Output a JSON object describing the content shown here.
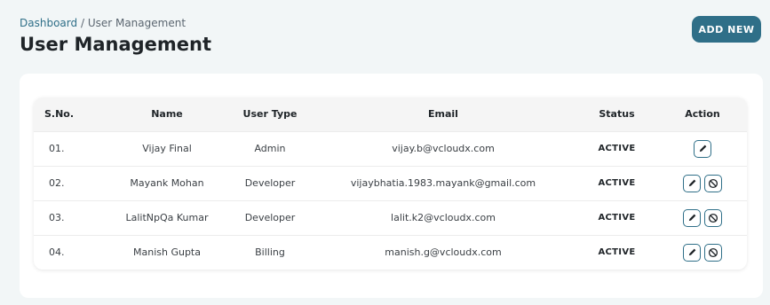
{
  "breadcrumb": {
    "root": "Dashboard",
    "separator": "/",
    "current": "User Management"
  },
  "page_title": "User Management",
  "add_button_label": "ADD NEW",
  "table": {
    "headers": [
      "S.No.",
      "Name",
      "User Type",
      "Email",
      "Status",
      "Action"
    ],
    "rows": [
      {
        "sno": "01.",
        "name": "Vijay Final",
        "user_type": "Admin",
        "email": "vijay.b@vcloudx.com",
        "status": "ACTIVE",
        "actions": [
          "edit-icon"
        ]
      },
      {
        "sno": "02.",
        "name": "Mayank Mohan",
        "user_type": "Developer",
        "email": "vijaybhatia.1983.mayank@gmail.com",
        "status": "ACTIVE",
        "actions": [
          "edit-icon",
          "block-icon"
        ]
      },
      {
        "sno": "03.",
        "name": "LalitNpQa Kumar",
        "user_type": "Developer",
        "email": "lalit.k2@vcloudx.com",
        "status": "ACTIVE",
        "actions": [
          "edit-icon",
          "block-icon"
        ]
      },
      {
        "sno": "04.",
        "name": "Manish Gupta",
        "user_type": "Billing",
        "email": "manish.g@vcloudx.com",
        "status": "ACTIVE",
        "actions": [
          "edit-icon",
          "block-icon"
        ]
      }
    ]
  },
  "colors": {
    "accent": "#2f6f88",
    "page_background": "#f2f6f7",
    "header_row_background": "#f5f5f5"
  }
}
